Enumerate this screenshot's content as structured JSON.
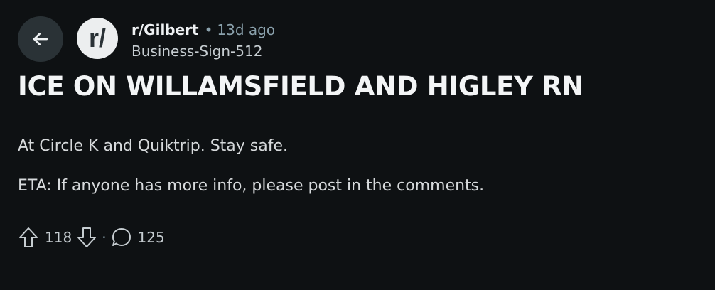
{
  "post": {
    "subreddit": "r/Gilbert",
    "separator": "•",
    "time_ago": "13d ago",
    "author": "Business-Sign-512",
    "avatar_text": "r/",
    "title": "ICE ON WILLAMSFIELD AND HIGLEY RN",
    "body": [
      "At Circle K and Quiktrip. Stay safe.",
      "ETA: If anyone has more info, please post in the comments."
    ]
  },
  "actions": {
    "score": "118",
    "dot": "·",
    "comment_count": "125"
  },
  "colors": {
    "background": "#0e1113",
    "back_button": "#2a3236",
    "avatar_bg": "#eceeef",
    "avatar_glyph": "#2a3236",
    "muted_text": "#8ba2ad"
  },
  "icons": {
    "back": "arrow-left-icon",
    "upvote": "arrow-up-icon",
    "downvote": "arrow-down-icon",
    "comments": "speech-bubble-icon"
  }
}
